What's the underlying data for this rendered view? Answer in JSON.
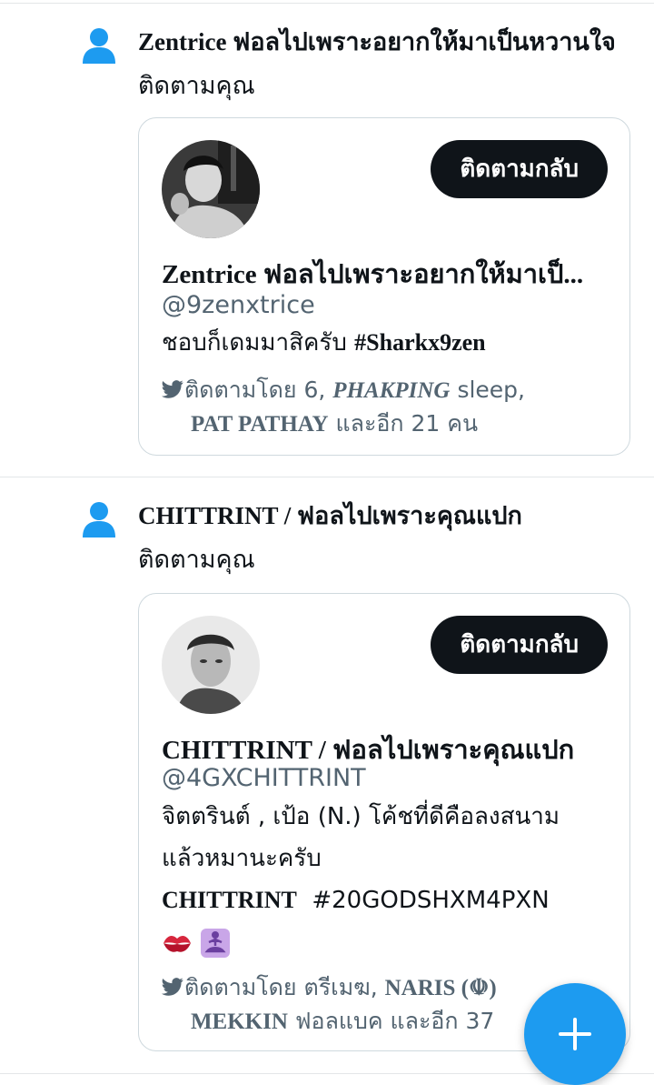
{
  "notifications": [
    {
      "headline_name": "Zentrice ฟอลไปเพราะอยากให้มาเป็นหวานใจ",
      "headline_action": "ติดตามคุณ",
      "card": {
        "follow_back_label": "ติดตามกลับ",
        "display_name": "Zentrice ฟอลไปเพราะอยากให้มาเป็...",
        "handle": "@9zenxtrice",
        "bio_text": "ชอบก็เดมมาสิครับ",
        "bio_hashtag": "#Sharkx9zen",
        "followed_by_prefix": "ติดตามโดย 6,",
        "followed_by_1": "PHAKPING",
        "followed_by_1_suffix": "sleep,",
        "followed_by_2": "PAT PATHAY",
        "followed_by_suffix": "และอีก 21 คน"
      }
    },
    {
      "headline_name": "CHITTRINT / ฟอลไปเพราะคุณแปก",
      "headline_action": "ติดตามคุณ",
      "card": {
        "follow_back_label": "ติดตามกลับ",
        "display_name": "CHITTRINT / ฟอลไปเพราะคุณแปก",
        "handle": "@4GXCHITTRINT",
        "bio_line1": "จิตตรินต์ , เป้อ (N.) โค้ชที่ดีคือลงสนาม",
        "bio_line2": "แล้วหมานะครับ",
        "bio_line3_name": "CHITTRINT",
        "bio_line3_hashtag": "#20GODSHXM4PXN",
        "followed_by_prefix": "ติดตามโดย ตรีเมฆ,",
        "followed_by_1": "NARIS (☫)",
        "followed_by_2": "MEKKIN",
        "followed_by_suffix": "ฟอลแบค และอีก 37"
      }
    }
  ],
  "colors": {
    "accent": "#1d9bf0",
    "button": "#0f1419",
    "secondary_text": "#536471",
    "border": "#cfd9de"
  },
  "icons": {
    "person": "person-icon",
    "bird": "bird-icon",
    "compose": "plus-icon",
    "emoji_1": "kiss-mark-emoji",
    "emoji_2": "person-in-lotus-position-emoji"
  }
}
